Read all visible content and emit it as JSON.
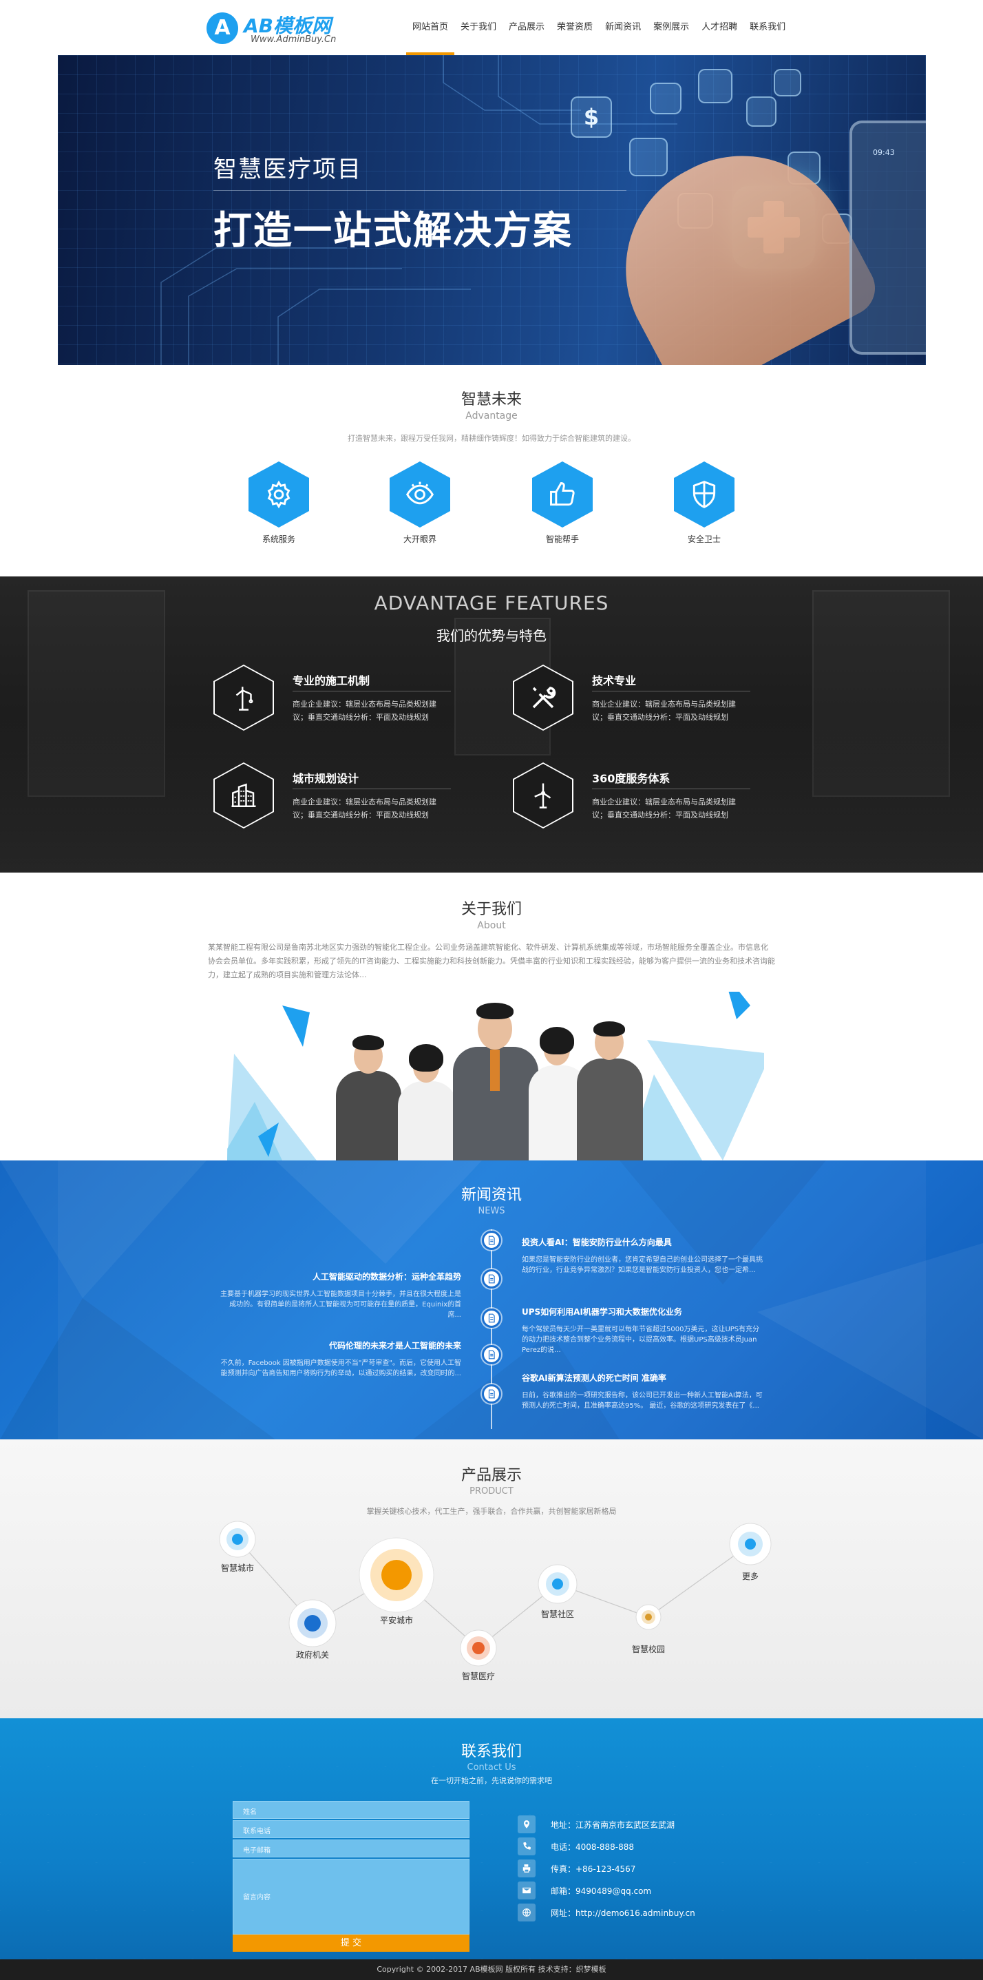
{
  "header": {
    "logo_mark": "A",
    "logo_title": "AB模板网",
    "logo_sub": "Www.AdminBuy.Cn",
    "nav": [
      "网站首页",
      "关于我们",
      "产品展示",
      "荣誉资质",
      "新闻资讯",
      "案例展示",
      "人才招聘",
      "联系我们"
    ],
    "active_index": 0,
    "accent_color": "#f39800"
  },
  "banner": {
    "line1": "智慧医疗项目",
    "line2": "打造一站式解决方案",
    "slide_count": 2,
    "tile_symbol": "$",
    "phone_time": "09:43"
  },
  "advantage": {
    "title": "智慧未来",
    "subtitle": "Advantage",
    "desc": "打造智慧未来，跟程万受任我网，精耕细作铸辉度！如得致力于综合智能建筑的建设。",
    "items": [
      {
        "label": "系统服务",
        "icon": "gear-icon"
      },
      {
        "label": "大开眼界",
        "icon": "eye-icon"
      },
      {
        "label": "智能帮手",
        "icon": "thumbs-up-icon"
      },
      {
        "label": "安全卫士",
        "icon": "shield-icon"
      }
    ],
    "brand_color": "#1ea0ef"
  },
  "features": {
    "title_en": "ADVANTAGE FEATURES",
    "title_zh": "我们的优势与特色",
    "items": [
      {
        "title": "专业的施工机制",
        "desc": "商业企业建议：辖层业态布局与品类规划建议；垂直交通动线分析：平面及动线规划",
        "icon": "crane-icon"
      },
      {
        "title": "技术专业",
        "desc": "商业企业建议：辖层业态布局与品类规划建议；垂直交通动线分析：平面及动线规划",
        "icon": "tools-icon"
      },
      {
        "title": "城市规划设计",
        "desc": "商业企业建议：辖层业态布局与品类规划建议；垂直交通动线分析：平面及动线规划",
        "icon": "buildings-icon"
      },
      {
        "title": "360度服务体系",
        "desc": "商业企业建议：辖层业态布局与品类规划建议；垂直交通动线分析：平面及动线规划",
        "icon": "wind-turbine-icon"
      }
    ]
  },
  "about": {
    "title": "关于我们",
    "subtitle": "About",
    "text": "某某智能工程有限公司是鲁南苏北地区实力强劲的智能化工程企业。公司业务涵盖建筑智能化、软件研发、计算机系统集成等领域，市场智能服务全覆盖企业。市信息化协会会员单位。多年实践积累，形成了领先的IT咨询能力、工程实施能力和科技创新能力。凭借丰富的行业知识和工程实践经验，能够为客户提供一流的业务和技术咨询能力，建立起了成熟的项目实施和管理方法论体..."
  },
  "news": {
    "title": "新闻资讯",
    "subtitle": "NEWS",
    "right_items": [
      {
        "title": "投资人看AI：智能安防行业什么方向最具",
        "desc": "如果您是智能安防行业的创业者，您肯定希望自己的创业公司选择了一个最具挑战的行业，行业竞争异常激烈？如果您是智能安防行业投资人，您也一定希..."
      },
      {
        "title": "UPS如何利用AI机器学习和大数据优化业务",
        "desc": "每个驾驶员每天少开一英里就可以每年节省超过5000万美元，这让UPS有充分的动力把技术整合到整个业务流程中，以提高效率。根据UPS高级技术员Juan Perez的说..."
      },
      {
        "title": "谷歌AI新算法预测人的死亡时间 准确率",
        "desc": "日前，谷歌推出的一项研究报告称，该公司已开发出一种新人工智能AI算法，可预测人的死亡时间，且准确率高达95%。 最近，谷歌的这项研究发表在了《..."
      }
    ],
    "left_items": [
      {
        "title": "人工智能驱动的数据分析：运种全革趋势",
        "desc": "主要基于机器学习的现实世界人工智能数据项目十分棘手，并且在很大程度上是成功的。有很简单的是将所人工智能视为可可能存在量的质量，Equinix的首席..."
      },
      {
        "title": "代码伦理的未来才是人工智能的未来",
        "desc": "不久前，Facebook 因被指用户数据使用不当\"严苛审查\"。而后，它使用人工智能预测并向广告商告知用户将购行为的举动，以通过购买的结果，改变同时的..."
      }
    ]
  },
  "products": {
    "title": "产品展示",
    "subtitle": "PRODUCT",
    "desc": "掌握关键核心技术，代工生产，强手联合，合作共赢，共创智能家居新格局",
    "nodes": [
      {
        "label": "智慧城市",
        "color": "#1ea0ef"
      },
      {
        "label": "政府机关",
        "color": "#1a6fcf"
      },
      {
        "label": "平安城市",
        "color": "#f39800"
      },
      {
        "label": "智慧医疗",
        "color": "#e8622c"
      },
      {
        "label": "智慧社区",
        "color": "#1ea0ef"
      },
      {
        "label": "智慧校园",
        "color": "#d99a2a"
      },
      {
        "label": "更多",
        "color": "#1ea0ef"
      }
    ]
  },
  "contact": {
    "title": "联系我们",
    "subtitle": "Contact Us",
    "desc": "在一切开始之前，先说说你的需求吧",
    "form": {
      "name_placeholder": "姓名",
      "phone_placeholder": "联系电话",
      "email_placeholder": "电子邮箱",
      "message_placeholder": "留言内容",
      "submit_label": "提 交"
    },
    "info": [
      {
        "label": "地址：江苏省南京市玄武区玄武湖",
        "icon": "location-icon"
      },
      {
        "label": "电话：4008-888-888",
        "icon": "phone-icon"
      },
      {
        "label": "传真：+86-123-4567",
        "icon": "fax-icon"
      },
      {
        "label": "邮箱：9490489@qq.com",
        "icon": "mail-icon"
      },
      {
        "label": "网址：http://demo616.adminbuy.cn",
        "icon": "web-icon"
      }
    ]
  },
  "footer": {
    "text": "Copyright © 2002-2017 AB模板网 版权所有   技术支持：织梦模板"
  }
}
